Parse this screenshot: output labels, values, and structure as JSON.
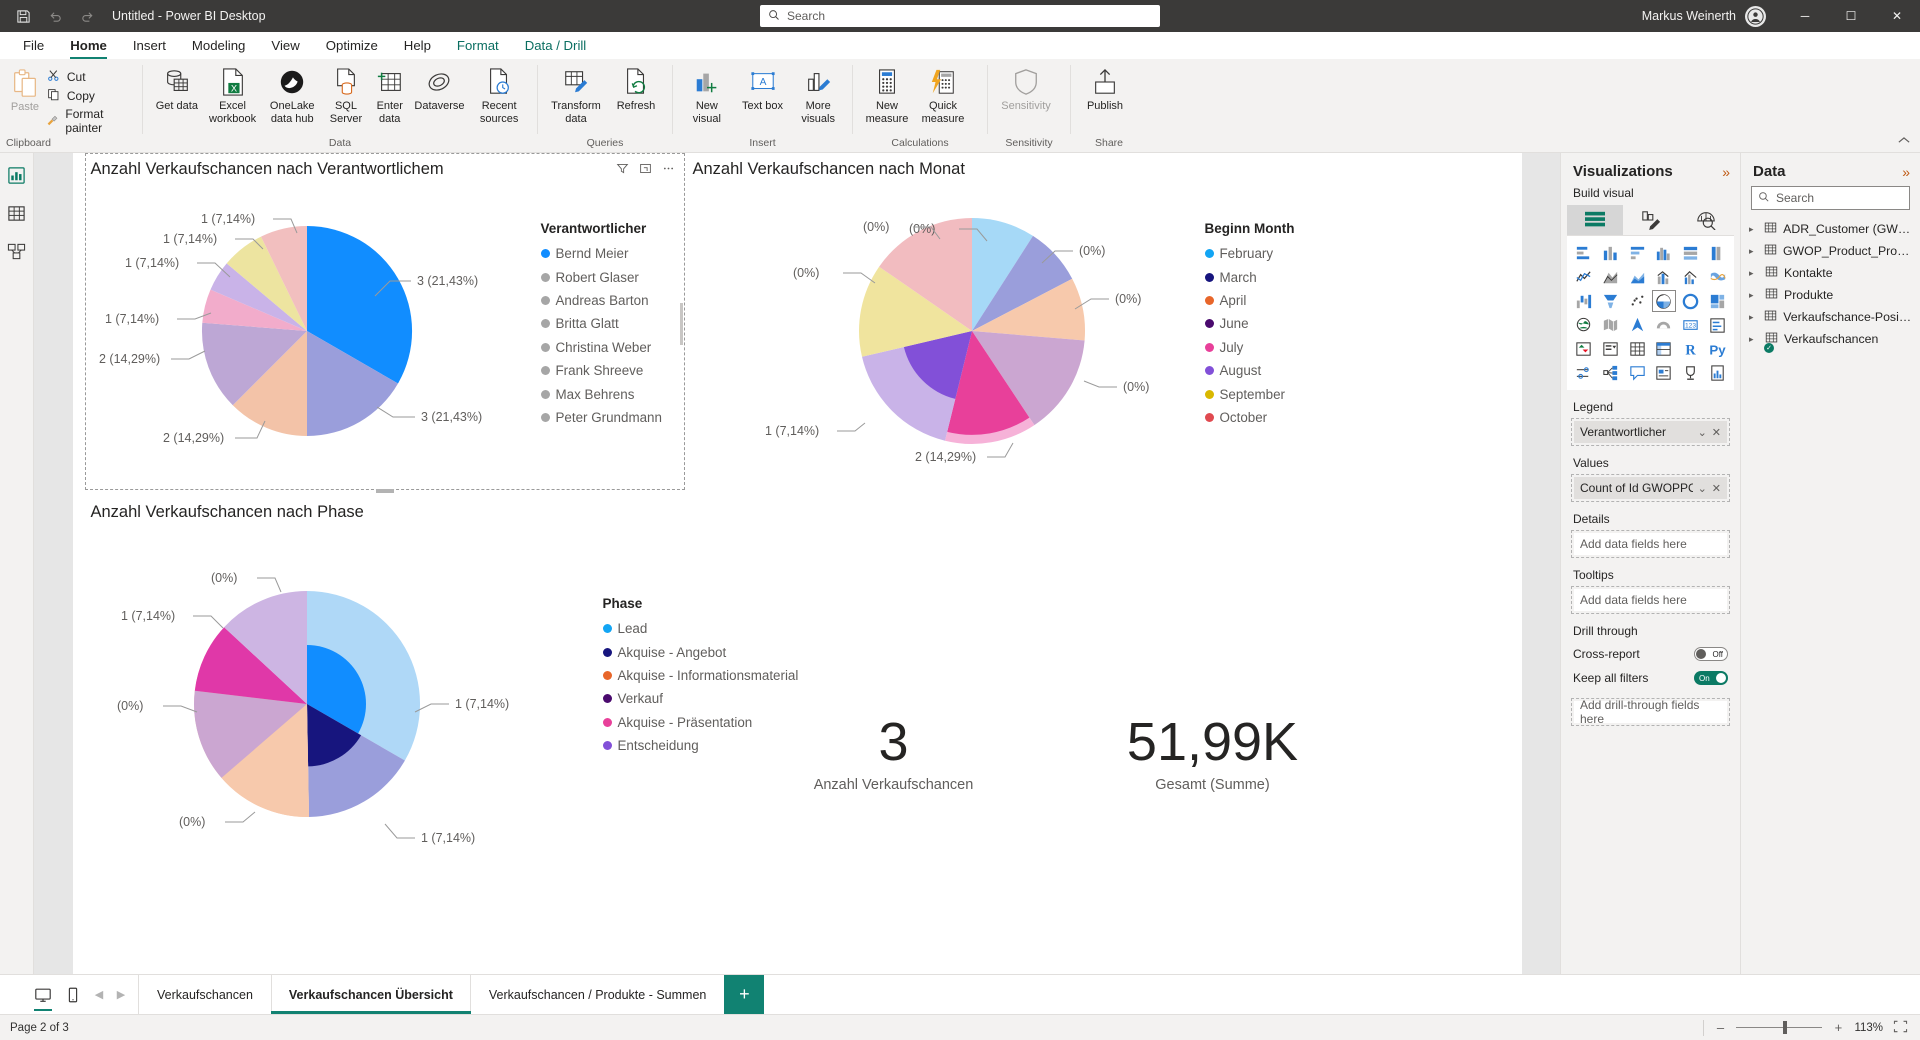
{
  "titlebar": {
    "app_title": "Untitled - Power BI Desktop",
    "save_icon": "save-icon",
    "undo_icon": "undo-icon",
    "redo_icon": "redo-icon",
    "search_placeholder": "Search",
    "user_name": "Markus Weinerth",
    "minimize": "─",
    "maximize": "☐",
    "close": "✕"
  },
  "menu": {
    "items": [
      {
        "label": "File",
        "state": "normal"
      },
      {
        "label": "Home",
        "state": "active"
      },
      {
        "label": "Insert",
        "state": "normal"
      },
      {
        "label": "Modeling",
        "state": "normal"
      },
      {
        "label": "View",
        "state": "normal"
      },
      {
        "label": "Optimize",
        "state": "normal"
      },
      {
        "label": "Help",
        "state": "normal"
      },
      {
        "label": "Format",
        "state": "context"
      },
      {
        "label": "Data / Drill",
        "state": "context-selected"
      }
    ]
  },
  "ribbon": {
    "groups": [
      {
        "name": "Clipboard",
        "label": "Clipboard",
        "paste_label": "Paste",
        "items": [
          {
            "label": "Cut",
            "icon": "scissors-icon"
          },
          {
            "label": "Copy",
            "icon": "copy-icon"
          },
          {
            "label": "Format painter",
            "icon": "paintbrush-icon"
          }
        ]
      },
      {
        "name": "Data",
        "label": "Data",
        "items": [
          {
            "label": "Get data",
            "icon": "database-icon",
            "dropdown": true
          },
          {
            "label": "Excel workbook",
            "icon": "excel-icon",
            "dropdown": false
          },
          {
            "label": "OneLake data hub",
            "icon": "onelake-icon",
            "dropdown": true
          },
          {
            "label": "SQL Server",
            "icon": "sql-server-icon",
            "dropdown": false
          },
          {
            "label": "Enter data",
            "icon": "enter-data-icon",
            "dropdown": false
          },
          {
            "label": "Dataverse",
            "icon": "dataverse-icon",
            "dropdown": false
          },
          {
            "label": "Recent sources",
            "icon": "recent-sources-icon",
            "dropdown": true
          }
        ]
      },
      {
        "name": "Queries",
        "label": "Queries",
        "items": [
          {
            "label": "Transform data",
            "icon": "transform-data-icon",
            "dropdown": true
          },
          {
            "label": "Refresh",
            "icon": "refresh-icon",
            "dropdown": false
          }
        ]
      },
      {
        "name": "Insert",
        "label": "Insert",
        "items": [
          {
            "label": "New visual",
            "icon": "new-visual-icon",
            "dropdown": false
          },
          {
            "label": "Text box",
            "icon": "text-box-icon",
            "dropdown": false
          },
          {
            "label": "More visuals",
            "icon": "more-visuals-icon",
            "dropdown": true
          }
        ]
      },
      {
        "name": "Calculations",
        "label": "Calculations",
        "items": [
          {
            "label": "New measure",
            "icon": "new-measure-icon",
            "dropdown": false
          },
          {
            "label": "Quick measure",
            "icon": "quick-measure-icon",
            "dropdown": false
          }
        ]
      },
      {
        "name": "Sensitivity",
        "label": "Sensitivity",
        "items": [
          {
            "label": "Sensitivity",
            "icon": "sensitivity-icon",
            "dropdown": true,
            "disabled": true
          }
        ]
      },
      {
        "name": "Share",
        "label": "Share",
        "items": [
          {
            "label": "Publish",
            "icon": "publish-icon",
            "dropdown": false
          }
        ]
      }
    ],
    "collapse_icon": "chevron-up-icon"
  },
  "navrail": {
    "items": [
      {
        "name": "report-view",
        "icon": "report-icon",
        "selected": true
      },
      {
        "name": "table-view",
        "icon": "table-icon",
        "selected": false
      },
      {
        "name": "model-view",
        "icon": "model-icon",
        "selected": false
      }
    ]
  },
  "visuals": {
    "chart1": {
      "title": "Anzahl Verkaufschancen nach Verantwortlichem",
      "legend_title": "Verantwortlicher",
      "tools": [
        "filter-icon",
        "focus-icon",
        "more-options-icon"
      ]
    },
    "chart2": {
      "title": "Anzahl Verkaufschancen nach Monat",
      "legend_title": "Beginn Month"
    },
    "chart3": {
      "title": "Anzahl Verkaufschancen nach Phase",
      "legend_title": "Phase"
    },
    "card1": {
      "value": "3",
      "label": "Anzahl Verkaufschancen"
    },
    "card2": {
      "value": "51,99K",
      "label": "Gesamt (Summe)"
    }
  },
  "chart_data": [
    {
      "type": "pie",
      "title": "Anzahl Verkaufschancen nach Verantwortlichem",
      "legend_title": "Verantwortlicher",
      "legend_position": "right",
      "categories": [
        "Bernd Meier",
        "Robert Glaser",
        "Andreas Barton",
        "Britta Glatt",
        "Christina Weber",
        "Frank Shreeve",
        "Max Behrens",
        "Peter Grundmann"
      ],
      "values": [
        3,
        3,
        2,
        2,
        1,
        1,
        1,
        1
      ],
      "percent": [
        21.43,
        21.43,
        14.29,
        14.29,
        7.14,
        7.14,
        7.14,
        7.14
      ],
      "data_labels": [
        "3 (21,43%)",
        "3 (21,43%)",
        "2 (14,29%)",
        "2 (14,29%)",
        "1 (7,14%)",
        "1 (7,14%)",
        "1 (7,14%)",
        "1 (7,14%)"
      ],
      "colors": [
        "#118DFF",
        "#9A9EDB",
        "#F0B8AE",
        "#C8A0CE",
        "#C8B0E0",
        "#EDE79E",
        "#F2C0C8",
        "#F5B8C4"
      ],
      "legend_highlight_index": 0
    },
    {
      "type": "pie",
      "title": "Anzahl Verkaufschancen nach Monat",
      "legend_title": "Beginn Month",
      "legend_position": "right",
      "categories": [
        "February",
        "March",
        "April",
        "June",
        "July",
        "August",
        "September",
        "October"
      ],
      "values": [
        0,
        0,
        0,
        0,
        2,
        1,
        0,
        0
      ],
      "data_labels": [
        "(0%)",
        "(0%)",
        "(0%)",
        "(0%)",
        "2 (14,29%)",
        "1 (7,14%)",
        "(0%)",
        "(0%)"
      ],
      "legend_colors": [
        "#12A5F4",
        "#17157E",
        "#E8662A",
        "#4A0A6E",
        "#E8409A",
        "#8250D8",
        "#D9B800",
        "#E04A50"
      ],
      "slice_colors": [
        "#A6D9F7",
        "#9A9EDB",
        "#F7C9AC",
        "#C8A0CE",
        "#E8409A",
        "#C9B3E8",
        "#F0E49E",
        "#F0B8BC"
      ],
      "highlight_slices": [
        {
          "index": 4,
          "inner_fraction": 0.92
        },
        {
          "index": 5,
          "inner_fraction": 0.62
        }
      ]
    },
    {
      "type": "pie",
      "title": "Anzahl Verkaufschancen nach Phase",
      "legend_title": "Phase",
      "legend_position": "right",
      "categories": [
        "Lead",
        "Akquise - Angebot",
        "Akquise - Informationsmaterial",
        "Verkauf",
        "Akquise - Präsentation",
        "Entscheidung"
      ],
      "values": [
        1,
        1,
        0,
        0,
        1,
        0
      ],
      "data_labels": [
        "1 (7,14%)",
        "1 (7,14%)",
        "(0%)",
        "(0%)",
        "1 (7,14%)",
        "(0%)"
      ],
      "legend_colors": [
        "#12A5F4",
        "#17157E",
        "#E8662A",
        "#4A0A6E",
        "#E8409A",
        "#8250D8"
      ],
      "slice_colors": [
        "#AFD8F7",
        "#9A9EDB",
        "#F7C9AC",
        "#C8A0CE",
        "#E038A8",
        "#CDB5E3"
      ],
      "highlight_slices": [
        {
          "index": 0,
          "inner_fraction": 0.5
        },
        {
          "index": 1,
          "inner_fraction": 0.55
        }
      ]
    }
  ],
  "legends": {
    "chart1": [
      {
        "label": "Bernd Meier",
        "color": "#118DFF",
        "active": true
      },
      {
        "label": "Robert Glaser",
        "color": "#A6A6A6",
        "active": false
      },
      {
        "label": "Andreas Barton",
        "color": "#A6A6A6",
        "active": false
      },
      {
        "label": "Britta Glatt",
        "color": "#A6A6A6",
        "active": false
      },
      {
        "label": "Christina Weber",
        "color": "#A6A6A6",
        "active": false
      },
      {
        "label": "Frank Shreeve",
        "color": "#A6A6A6",
        "active": false
      },
      {
        "label": "Max Behrens",
        "color": "#A6A6A6",
        "active": false
      },
      {
        "label": "Peter Grundmann",
        "color": "#A6A6A6",
        "active": false
      }
    ],
    "chart2": [
      {
        "label": "February",
        "color": "#12A5F4"
      },
      {
        "label": "March",
        "color": "#17157E"
      },
      {
        "label": "April",
        "color": "#E8662A"
      },
      {
        "label": "June",
        "color": "#4A0A6E"
      },
      {
        "label": "July",
        "color": "#E8409A"
      },
      {
        "label": "August",
        "color": "#8250D8"
      },
      {
        "label": "September",
        "color": "#D9B800"
      },
      {
        "label": "October",
        "color": "#E04A50"
      }
    ],
    "chart3": [
      {
        "label": "Lead",
        "color": "#12A5F4"
      },
      {
        "label": "Akquise - Angebot",
        "color": "#17157E"
      },
      {
        "label": "Akquise - Informationsmaterial",
        "color": "#E8662A"
      },
      {
        "label": "Verkauf",
        "color": "#4A0A6E"
      },
      {
        "label": "Akquise - Präsentation",
        "color": "#E8409A"
      },
      {
        "label": "Entscheidung",
        "color": "#8250D8"
      }
    ]
  },
  "viz_pane": {
    "title": "Visualizations",
    "collapse_icon": "chevron-double-right-icon",
    "build_label": "Build visual",
    "tabs": [
      {
        "name": "build-visual-tab",
        "icon": "fields-icon",
        "selected": true
      },
      {
        "name": "format-visual-tab",
        "icon": "format-paint-icon",
        "selected": false
      },
      {
        "name": "analytics-tab",
        "icon": "analytics-magnifier-icon",
        "selected": false
      }
    ],
    "gallery": [
      "stacked-bar-chart",
      "stacked-column-chart",
      "clustered-bar-chart",
      "clustered-column-chart",
      "100-stacked-bar-chart",
      "100-stacked-column-chart",
      "line-chart",
      "area-chart",
      "stacked-area-chart",
      "line-stacked-column-chart",
      "line-clustered-column-chart",
      "ribbon-chart",
      "waterfall-chart",
      "funnel-chart",
      "scatter-chart",
      "pie-chart",
      "donut-chart",
      "treemap-chart",
      "map-visual",
      "filled-map",
      "azure-map",
      "arcgis-map",
      "card-visual",
      "multi-row-card",
      "kpi-visual",
      "slicer-visual",
      "table-visual",
      "matrix-visual",
      "r-script-visual",
      "python-visual",
      "key-influencers",
      "decomposition-tree",
      "qna-visual",
      "smart-narrative",
      "paginated-report",
      "metrics-visual"
    ],
    "gallery_selected": "pie-chart",
    "wells": [
      {
        "label": "Legend",
        "field": "Verantwortlicher",
        "empty": false
      },
      {
        "label": "Values",
        "field": "Count of Id GWOPPO...",
        "empty": false
      },
      {
        "label": "Details",
        "field": "Add data fields here",
        "empty": true
      },
      {
        "label": "Tooltips",
        "field": "Add data fields here",
        "empty": true
      }
    ],
    "drill_through": {
      "label": "Drill through",
      "cross_report": {
        "label": "Cross-report",
        "state": "Off"
      },
      "keep_all_filters": {
        "label": "Keep all filters",
        "state": "On"
      },
      "add_fields": "Add drill-through fields here"
    }
  },
  "data_pane": {
    "title": "Data",
    "collapse_icon": "chevron-double-right-icon",
    "search_placeholder": "Search",
    "tables": [
      {
        "name": "ADR_Customer (GWOP...",
        "checked": false
      },
      {
        "name": "GWOP_Product_Produc...",
        "checked": false
      },
      {
        "name": "Kontakte",
        "checked": false
      },
      {
        "name": "Produkte",
        "checked": false
      },
      {
        "name": "Verkaufschance-Positio...",
        "checked": false
      },
      {
        "name": "Verkaufschancen",
        "checked": true
      }
    ]
  },
  "page_tabs": {
    "view_buttons": [
      {
        "name": "desktop-layout",
        "icon": "desktop-icon",
        "selected": true
      },
      {
        "name": "mobile-layout",
        "icon": "mobile-icon",
        "selected": false
      }
    ],
    "prev_icon": "chevron-left-icon",
    "next_icon": "chevron-right-icon",
    "tabs": [
      {
        "label": "Verkaufschancen",
        "selected": false
      },
      {
        "label": "Verkaufschancen Übersicht",
        "selected": true
      },
      {
        "label": "Verkaufschancen / Produkte - Summen",
        "selected": false
      }
    ],
    "add_label": "+"
  },
  "statusbar": {
    "page_status": "Page 2 of 3",
    "zoom_minus": "–",
    "zoom_plus": "+",
    "zoom_percent": "113%",
    "fit_icon": "fit-to-page-icon"
  }
}
